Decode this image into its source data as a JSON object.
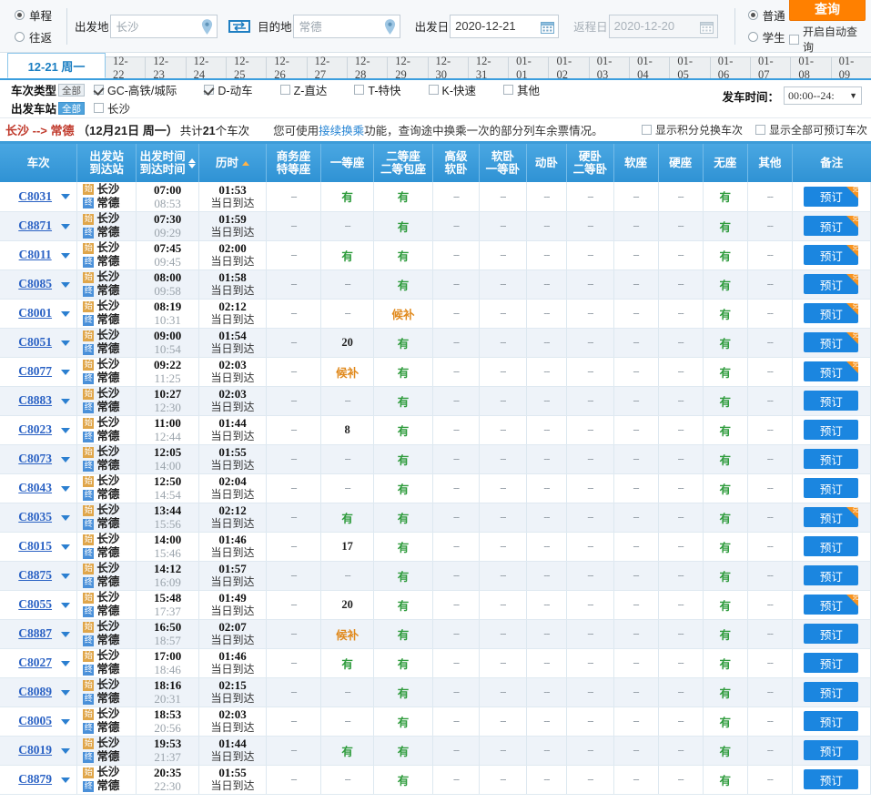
{
  "search": {
    "trip_types": [
      {
        "label": "单程",
        "selected": true
      },
      {
        "label": "往返",
        "selected": false
      }
    ],
    "from_label": "出发地",
    "from_value": "长沙",
    "to_label": "目的地",
    "to_value": "常德",
    "depart_label": "出发日",
    "depart_value": "2020-12-21",
    "return_label": "返程日",
    "return_value": "2020-12-20",
    "pax_types": [
      {
        "label": "普通",
        "selected": true
      },
      {
        "label": "学生",
        "selected": false
      }
    ],
    "query_button": "查询",
    "auto_query_label": "开启自动查询",
    "auto_query_checked": false,
    "accent_orange": "#ff8000",
    "accent_blue": "#3d9cd8"
  },
  "date_tabs": {
    "active": "12-21 周一",
    "items": [
      "12-22",
      "12-23",
      "12-24",
      "12-25",
      "12-26",
      "12-27",
      "12-28",
      "12-29",
      "12-30",
      "12-31",
      "01-01",
      "01-02",
      "01-03",
      "01-04",
      "01-05",
      "01-06",
      "01-07",
      "01-08",
      "01-09"
    ]
  },
  "filters": {
    "train_type_label": "车次类型",
    "train_type_all": "全部",
    "train_type_all_selected": false,
    "train_types": [
      {
        "label": "GC-高铁/城际",
        "checked": true
      },
      {
        "label": "D-动车",
        "checked": true
      },
      {
        "label": "Z-直达",
        "checked": false
      },
      {
        "label": "T-特快",
        "checked": false
      },
      {
        "label": "K-快速",
        "checked": false
      },
      {
        "label": "其他",
        "checked": false
      }
    ],
    "station_label": "出发车站",
    "station_all": "全部",
    "station_all_selected": true,
    "stations": [
      {
        "label": "长沙",
        "checked": false
      }
    ],
    "depart_time_label": "发车时间：",
    "depart_time_value": "00:00--24:"
  },
  "info": {
    "from": "长沙",
    "arrow": "-->",
    "to": "常德",
    "date": "（12月21日  周一）",
    "count_prefix": "共计",
    "count": "21",
    "count_suffix": "个车次",
    "tip_pre": "您可使用",
    "tip_link": "接续换乘",
    "tip_post": "功能，查询途中换乘一次的部分列车余票情况。",
    "checks": [
      {
        "label": "显示积分兑换车次",
        "checked": false
      },
      {
        "label": "显示全部可预订车次",
        "checked": false
      }
    ]
  },
  "table": {
    "headers": [
      {
        "key": "train",
        "lines": [
          "车次"
        ]
      },
      {
        "key": "station",
        "lines": [
          "出发站",
          "到达站"
        ]
      },
      {
        "key": "time",
        "lines": [
          "出发时间",
          "到达时间"
        ],
        "sortable": true
      },
      {
        "key": "duration",
        "lines": [
          "历时"
        ],
        "sort_asc": true
      },
      {
        "key": "business",
        "lines": [
          "商务座",
          "特等座"
        ]
      },
      {
        "key": "first",
        "lines": [
          "一等座"
        ]
      },
      {
        "key": "second",
        "lines": [
          "二等座",
          "二等包座"
        ]
      },
      {
        "key": "senior_soft_sleeper",
        "lines": [
          "高级",
          "软卧"
        ]
      },
      {
        "key": "soft_sleeper",
        "lines": [
          "软卧",
          "一等卧"
        ]
      },
      {
        "key": "motor_sleeper",
        "lines": [
          "动卧"
        ]
      },
      {
        "key": "hard_sleeper",
        "lines": [
          "硬卧",
          "二等卧"
        ]
      },
      {
        "key": "soft_seat",
        "lines": [
          "软座"
        ]
      },
      {
        "key": "hard_seat",
        "lines": [
          "硬座"
        ]
      },
      {
        "key": "no_seat",
        "lines": [
          "无座"
        ]
      },
      {
        "key": "other",
        "lines": [
          "其他"
        ]
      },
      {
        "key": "remark",
        "lines": [
          "备注"
        ]
      }
    ],
    "badge_start": "始",
    "badge_end": "终",
    "arrive_same_day": "当日到达",
    "book_label": "预订",
    "exchange_mark": "兑",
    "none": "--",
    "rows": [
      {
        "train": "C8031",
        "from": "长沙",
        "to": "常德",
        "dep": "07:00",
        "arr": "08:53",
        "dur": "01:53",
        "day": "当日到达",
        "business": "--",
        "first": "有",
        "second": "有",
        "senior_soft_sleeper": "--",
        "soft_sleeper": "--",
        "motor_sleeper": "--",
        "hard_sleeper": "--",
        "soft_seat": "--",
        "hard_seat": "--",
        "no_seat": "有",
        "other": "--",
        "book": "预订",
        "exchange": true
      },
      {
        "train": "C8871",
        "from": "长沙",
        "to": "常德",
        "dep": "07:30",
        "arr": "09:29",
        "dur": "01:59",
        "day": "当日到达",
        "business": "--",
        "first": "--",
        "second": "有",
        "senior_soft_sleeper": "--",
        "soft_sleeper": "--",
        "motor_sleeper": "--",
        "hard_sleeper": "--",
        "soft_seat": "--",
        "hard_seat": "--",
        "no_seat": "有",
        "other": "--",
        "book": "预订",
        "exchange": true
      },
      {
        "train": "C8011",
        "from": "长沙",
        "to": "常德",
        "dep": "07:45",
        "arr": "09:45",
        "dur": "02:00",
        "day": "当日到达",
        "business": "--",
        "first": "有",
        "second": "有",
        "senior_soft_sleeper": "--",
        "soft_sleeper": "--",
        "motor_sleeper": "--",
        "hard_sleeper": "--",
        "soft_seat": "--",
        "hard_seat": "--",
        "no_seat": "有",
        "other": "--",
        "book": "预订",
        "exchange": true
      },
      {
        "train": "C8085",
        "from": "长沙",
        "to": "常德",
        "dep": "08:00",
        "arr": "09:58",
        "dur": "01:58",
        "day": "当日到达",
        "business": "--",
        "first": "--",
        "second": "有",
        "senior_soft_sleeper": "--",
        "soft_sleeper": "--",
        "motor_sleeper": "--",
        "hard_sleeper": "--",
        "soft_seat": "--",
        "hard_seat": "--",
        "no_seat": "有",
        "other": "--",
        "book": "预订",
        "exchange": true
      },
      {
        "train": "C8001",
        "from": "长沙",
        "to": "常德",
        "dep": "08:19",
        "arr": "10:31",
        "dur": "02:12",
        "day": "当日到达",
        "business": "--",
        "first": "--",
        "second": "候补",
        "senior_soft_sleeper": "--",
        "soft_sleeper": "--",
        "motor_sleeper": "--",
        "hard_sleeper": "--",
        "soft_seat": "--",
        "hard_seat": "--",
        "no_seat": "有",
        "other": "--",
        "book": "预订",
        "exchange": true
      },
      {
        "train": "C8051",
        "from": "长沙",
        "to": "常德",
        "dep": "09:00",
        "arr": "10:54",
        "dur": "01:54",
        "day": "当日到达",
        "business": "--",
        "first": "20",
        "second": "有",
        "senior_soft_sleeper": "--",
        "soft_sleeper": "--",
        "motor_sleeper": "--",
        "hard_sleeper": "--",
        "soft_seat": "--",
        "hard_seat": "--",
        "no_seat": "有",
        "other": "--",
        "book": "预订",
        "exchange": true
      },
      {
        "train": "C8077",
        "from": "长沙",
        "to": "常德",
        "dep": "09:22",
        "arr": "11:25",
        "dur": "02:03",
        "day": "当日到达",
        "business": "--",
        "first": "候补",
        "second": "有",
        "senior_soft_sleeper": "--",
        "soft_sleeper": "--",
        "motor_sleeper": "--",
        "hard_sleeper": "--",
        "soft_seat": "--",
        "hard_seat": "--",
        "no_seat": "有",
        "other": "--",
        "book": "预订",
        "exchange": true
      },
      {
        "train": "C8883",
        "from": "长沙",
        "to": "常德",
        "dep": "10:27",
        "arr": "12:30",
        "dur": "02:03",
        "day": "当日到达",
        "business": "--",
        "first": "--",
        "second": "有",
        "senior_soft_sleeper": "--",
        "soft_sleeper": "--",
        "motor_sleeper": "--",
        "hard_sleeper": "--",
        "soft_seat": "--",
        "hard_seat": "--",
        "no_seat": "有",
        "other": "--",
        "book": "预订",
        "exchange": false
      },
      {
        "train": "C8023",
        "from": "长沙",
        "to": "常德",
        "dep": "11:00",
        "arr": "12:44",
        "dur": "01:44",
        "day": "当日到达",
        "business": "--",
        "first": "8",
        "second": "有",
        "senior_soft_sleeper": "--",
        "soft_sleeper": "--",
        "motor_sleeper": "--",
        "hard_sleeper": "--",
        "soft_seat": "--",
        "hard_seat": "--",
        "no_seat": "有",
        "other": "--",
        "book": "预订",
        "exchange": false
      },
      {
        "train": "C8073",
        "from": "长沙",
        "to": "常德",
        "dep": "12:05",
        "arr": "14:00",
        "dur": "01:55",
        "day": "当日到达",
        "business": "--",
        "first": "--",
        "second": "有",
        "senior_soft_sleeper": "--",
        "soft_sleeper": "--",
        "motor_sleeper": "--",
        "hard_sleeper": "--",
        "soft_seat": "--",
        "hard_seat": "--",
        "no_seat": "有",
        "other": "--",
        "book": "预订",
        "exchange": false
      },
      {
        "train": "C8043",
        "from": "长沙",
        "to": "常德",
        "dep": "12:50",
        "arr": "14:54",
        "dur": "02:04",
        "day": "当日到达",
        "business": "--",
        "first": "--",
        "second": "有",
        "senior_soft_sleeper": "--",
        "soft_sleeper": "--",
        "motor_sleeper": "--",
        "hard_sleeper": "--",
        "soft_seat": "--",
        "hard_seat": "--",
        "no_seat": "有",
        "other": "--",
        "book": "预订",
        "exchange": false
      },
      {
        "train": "C8035",
        "from": "长沙",
        "to": "常德",
        "dep": "13:44",
        "arr": "15:56",
        "dur": "02:12",
        "day": "当日到达",
        "business": "--",
        "first": "有",
        "second": "有",
        "senior_soft_sleeper": "--",
        "soft_sleeper": "--",
        "motor_sleeper": "--",
        "hard_sleeper": "--",
        "soft_seat": "--",
        "hard_seat": "--",
        "no_seat": "有",
        "other": "--",
        "book": "预订",
        "exchange": true
      },
      {
        "train": "C8015",
        "from": "长沙",
        "to": "常德",
        "dep": "14:00",
        "arr": "15:46",
        "dur": "01:46",
        "day": "当日到达",
        "business": "--",
        "first": "17",
        "second": "有",
        "senior_soft_sleeper": "--",
        "soft_sleeper": "--",
        "motor_sleeper": "--",
        "hard_sleeper": "--",
        "soft_seat": "--",
        "hard_seat": "--",
        "no_seat": "有",
        "other": "--",
        "book": "预订",
        "exchange": false
      },
      {
        "train": "C8875",
        "from": "长沙",
        "to": "常德",
        "dep": "14:12",
        "arr": "16:09",
        "dur": "01:57",
        "day": "当日到达",
        "business": "--",
        "first": "--",
        "second": "有",
        "senior_soft_sleeper": "--",
        "soft_sleeper": "--",
        "motor_sleeper": "--",
        "hard_sleeper": "--",
        "soft_seat": "--",
        "hard_seat": "--",
        "no_seat": "有",
        "other": "--",
        "book": "预订",
        "exchange": false
      },
      {
        "train": "C8055",
        "from": "长沙",
        "to": "常德",
        "dep": "15:48",
        "arr": "17:37",
        "dur": "01:49",
        "day": "当日到达",
        "business": "--",
        "first": "20",
        "second": "有",
        "senior_soft_sleeper": "--",
        "soft_sleeper": "--",
        "motor_sleeper": "--",
        "hard_sleeper": "--",
        "soft_seat": "--",
        "hard_seat": "--",
        "no_seat": "有",
        "other": "--",
        "book": "预订",
        "exchange": true
      },
      {
        "train": "C8887",
        "from": "长沙",
        "to": "常德",
        "dep": "16:50",
        "arr": "18:57",
        "dur": "02:07",
        "day": "当日到达",
        "business": "--",
        "first": "候补",
        "second": "有",
        "senior_soft_sleeper": "--",
        "soft_sleeper": "--",
        "motor_sleeper": "--",
        "hard_sleeper": "--",
        "soft_seat": "--",
        "hard_seat": "--",
        "no_seat": "有",
        "other": "--",
        "book": "预订",
        "exchange": false
      },
      {
        "train": "C8027",
        "from": "长沙",
        "to": "常德",
        "dep": "17:00",
        "arr": "18:46",
        "dur": "01:46",
        "day": "当日到达",
        "business": "--",
        "first": "有",
        "second": "有",
        "senior_soft_sleeper": "--",
        "soft_sleeper": "--",
        "motor_sleeper": "--",
        "hard_sleeper": "--",
        "soft_seat": "--",
        "hard_seat": "--",
        "no_seat": "有",
        "other": "--",
        "book": "预订",
        "exchange": false
      },
      {
        "train": "C8089",
        "from": "长沙",
        "to": "常德",
        "dep": "18:16",
        "arr": "20:31",
        "dur": "02:15",
        "day": "当日到达",
        "business": "--",
        "first": "--",
        "second": "有",
        "senior_soft_sleeper": "--",
        "soft_sleeper": "--",
        "motor_sleeper": "--",
        "hard_sleeper": "--",
        "soft_seat": "--",
        "hard_seat": "--",
        "no_seat": "有",
        "other": "--",
        "book": "预订",
        "exchange": false
      },
      {
        "train": "C8005",
        "from": "长沙",
        "to": "常德",
        "dep": "18:53",
        "arr": "20:56",
        "dur": "02:03",
        "day": "当日到达",
        "business": "--",
        "first": "--",
        "second": "有",
        "senior_soft_sleeper": "--",
        "soft_sleeper": "--",
        "motor_sleeper": "--",
        "hard_sleeper": "--",
        "soft_seat": "--",
        "hard_seat": "--",
        "no_seat": "有",
        "other": "--",
        "book": "预订",
        "exchange": false
      },
      {
        "train": "C8019",
        "from": "长沙",
        "to": "常德",
        "dep": "19:53",
        "arr": "21:37",
        "dur": "01:44",
        "day": "当日到达",
        "business": "--",
        "first": "有",
        "second": "有",
        "senior_soft_sleeper": "--",
        "soft_sleeper": "--",
        "motor_sleeper": "--",
        "hard_sleeper": "--",
        "soft_seat": "--",
        "hard_seat": "--",
        "no_seat": "有",
        "other": "--",
        "book": "预订",
        "exchange": false
      },
      {
        "train": "C8879",
        "from": "长沙",
        "to": "常德",
        "dep": "20:35",
        "arr": "22:30",
        "dur": "01:55",
        "day": "当日到达",
        "business": "--",
        "first": "--",
        "second": "有",
        "senior_soft_sleeper": "--",
        "soft_sleeper": "--",
        "motor_sleeper": "--",
        "hard_sleeper": "--",
        "soft_seat": "--",
        "hard_seat": "--",
        "no_seat": "有",
        "other": "--",
        "book": "预订",
        "exchange": false
      }
    ]
  }
}
